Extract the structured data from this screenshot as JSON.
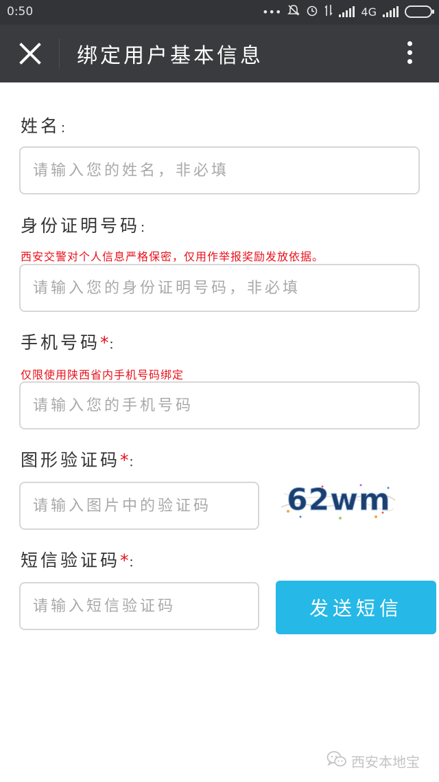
{
  "status_bar": {
    "time": "0:50",
    "network": "4G"
  },
  "header": {
    "title": "绑定用户基本信息"
  },
  "form": {
    "name": {
      "label": "姓名",
      "placeholder": "请输入您的姓名，非必填"
    },
    "id_number": {
      "label": "身份证明号码",
      "note": "西安交警对个人信息严格保密，仅用作举报奖励发放依据。",
      "placeholder": "请输入您的身份证明号码，非必填"
    },
    "phone": {
      "label": "手机号码",
      "required_mark": "*",
      "note": "仅限使用陕西省内手机号码绑定",
      "placeholder": "请输入您的手机号码"
    },
    "captcha": {
      "label": "图形验证码",
      "required_mark": "*",
      "placeholder": "请输入图片中的验证码",
      "image_text": "62wm"
    },
    "sms_code": {
      "label": "短信验证码",
      "required_mark": "*",
      "placeholder": "请输入短信验证码",
      "button_label": "发送短信"
    },
    "colon": "："
  },
  "watermark": {
    "text": "西安本地宝"
  },
  "colors": {
    "accent": "#26b8e6",
    "required": "#e8101a",
    "nav_background": "#3a3b3e"
  }
}
